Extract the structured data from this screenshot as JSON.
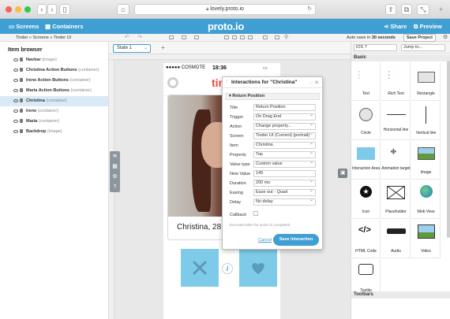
{
  "browser": {
    "url": "lovely.proto.io"
  },
  "header": {
    "screens_label": "Screens",
    "containers_label": "Containers",
    "logo": "proto.io",
    "share_label": "Share",
    "preview_label": "Preview"
  },
  "toolbar": {
    "breadcrumb": "Tinder » Screens » Tinder UI",
    "autosave_prefix": "Auto save in",
    "autosave_value": "30 seconds",
    "save_project_label": "Save Project"
  },
  "item_browser": {
    "title": "Item browser",
    "items": [
      {
        "name": "Navbar",
        "type": "(image)"
      },
      {
        "name": "Christina Action Buttons",
        "type": "(container)"
      },
      {
        "name": "Irene Action Buttons",
        "type": "(container)"
      },
      {
        "name": "Maria Action Buttons",
        "type": "(container)"
      },
      {
        "name": "Christina",
        "type": "(container)"
      },
      {
        "name": "Irene",
        "type": "(container)"
      },
      {
        "name": "Maria",
        "type": "(container)"
      },
      {
        "name": "Backdrop",
        "type": "(image)"
      }
    ]
  },
  "canvas": {
    "state_tab": "State 1",
    "add_state": "+"
  },
  "phone": {
    "carrier": "●●●●● COSMOTE",
    "time": "18:36",
    "logo_text": "tin",
    "card_name": "Christina, 28",
    "info_label": "i"
  },
  "dialog": {
    "title": "Interactions for \"Christina\"",
    "section": "Return Position",
    "fields": [
      {
        "label": "Title",
        "value": "Return Position",
        "dropdown": false
      },
      {
        "label": "Trigger",
        "value": "On Drag End",
        "dropdown": true
      },
      {
        "label": "Action",
        "value": "Change property...",
        "dropdown": true
      },
      {
        "label": "Screen",
        "value": "Tinder UI (Current) (portrait)",
        "dropdown": true
      },
      {
        "label": "Item",
        "value": "Christina",
        "dropdown": true
      },
      {
        "label": "Property",
        "value": "Top",
        "dropdown": true
      },
      {
        "label": "Value type",
        "value": "Custom value",
        "dropdown": true
      },
      {
        "label": "New Value",
        "value": "145",
        "dropdown": false
      },
      {
        "label": "Duration",
        "value": "200 ms",
        "dropdown": true
      },
      {
        "label": "Easing",
        "value": "Ease out - Quad",
        "dropdown": true
      },
      {
        "label": "Delay",
        "value": "No delay",
        "dropdown": true
      }
    ],
    "callback_label": "Callback",
    "note": "Executed after the action is completed",
    "cancel_label": "Cancel",
    "save_label": "Save Interaction"
  },
  "right_panel": {
    "device_select": "iOS 7",
    "jump_select": "Jump to...",
    "basic_header": "Basic",
    "toolbars_header": "Toolbars",
    "components": [
      {
        "label": "Text"
      },
      {
        "label": "Rich Text"
      },
      {
        "label": "Rectangle"
      },
      {
        "label": "Circle"
      },
      {
        "label": "Horizontal line"
      },
      {
        "label": "Vertical line"
      },
      {
        "label": "Interaction Area"
      },
      {
        "label": "Animation target"
      },
      {
        "label": "Image"
      },
      {
        "label": "Icon"
      },
      {
        "label": "Placeholder"
      },
      {
        "label": "Web View"
      },
      {
        "label": "HTML Code"
      },
      {
        "label": "Audio"
      },
      {
        "label": "Video"
      },
      {
        "label": "Tooltip"
      }
    ]
  },
  "colors": {
    "accent": "#3f9fd3",
    "tile_blue": "#7dcbe9",
    "selection": "#d9eaf6"
  }
}
